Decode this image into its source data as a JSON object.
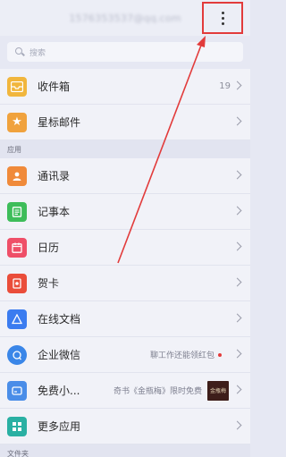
{
  "header": {
    "account": "1576353537@qq.com"
  },
  "search": {
    "placeholder": "搜索"
  },
  "mail": [
    {
      "label": "收件箱",
      "count": "19"
    },
    {
      "label": "星标邮件"
    }
  ],
  "sections": {
    "apps": "应用",
    "folders": "文件夹"
  },
  "apps": [
    {
      "label": "通讯录"
    },
    {
      "label": "记事本"
    },
    {
      "label": "日历"
    },
    {
      "label": "贺卡"
    },
    {
      "label": "在线文档"
    },
    {
      "label": "企业微信",
      "note": "聊工作还能领红包"
    },
    {
      "label": "免费小...",
      "note": "奇书《金瓶梅》限时免费",
      "thumb": "金瓶梅"
    },
    {
      "label": "更多应用"
    }
  ],
  "colors": {
    "annotation_red": "#e23b3b",
    "inbox": "#f1b63d",
    "star": "#f0a23d",
    "contacts": "#f08a3a",
    "notes": "#3ebd5a",
    "calendar": "#ef4f68",
    "card": "#ea4d3a",
    "docs": "#3b7cf0",
    "wechat_work": "#3a86e8",
    "mini": "#4a8de8",
    "more": "#2ab0a3"
  }
}
